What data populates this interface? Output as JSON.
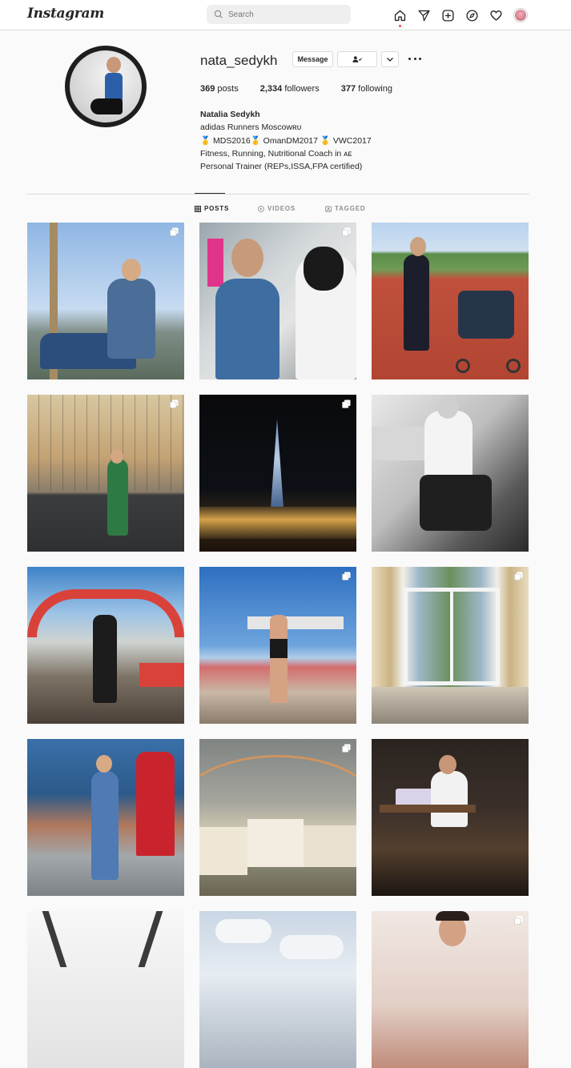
{
  "nav": {
    "logo": "Instagram",
    "search_placeholder": "Search",
    "icons": [
      "home-icon",
      "direct-icon",
      "new-post-icon",
      "explore-icon",
      "activity-icon",
      "profile-avatar"
    ]
  },
  "profile": {
    "username": "nata_sedykh",
    "message_label": "Message",
    "stats": {
      "posts_count": "369",
      "posts_label": "posts",
      "followers_count": "2,334",
      "followers_label": "followers",
      "following_count": "377",
      "following_label": "following"
    },
    "bio": {
      "name": "Natalia Sedykh",
      "line1": "adidas Runners Moscowʀᴜ",
      "line2_parts": [
        "🥇",
        " MDS2016",
        "🥇",
        " OmanDM2017 ",
        "🥇",
        " VWC2017"
      ],
      "line3": "Fitness, Running, Nutritional Coach in ᴀᴇ",
      "line4": "Personal Trainer (REPs,ISSA,FPA certified)"
    }
  },
  "tabs": [
    {
      "label": "POSTS",
      "icon": "grid-icon",
      "active": true
    },
    {
      "label": "VIDEOS",
      "icon": "video-icon",
      "active": false
    },
    {
      "label": "TAGGED",
      "icon": "tagged-icon",
      "active": false
    }
  ],
  "posts": [
    {
      "scene": "woman-by-palm-tree",
      "multi": true
    },
    {
      "scene": "makeup-artist",
      "multi": true
    },
    {
      "scene": "woman-with-stroller-at-track",
      "multi": false
    },
    {
      "scene": "pregnant-woman-on-court",
      "multi": true
    },
    {
      "scene": "burj-khalifa-night",
      "multi": true
    },
    {
      "scene": "woman-with-laptop-bw",
      "multi": false
    },
    {
      "scene": "runner-at-finish-arch",
      "multi": false
    },
    {
      "scene": "woman-in-stadium",
      "multi": true
    },
    {
      "scene": "room-with-mountain-view",
      "multi": true
    },
    {
      "scene": "woman-by-phone-booth",
      "multi": false
    },
    {
      "scene": "rainbow-over-houses",
      "multi": true
    },
    {
      "scene": "woman-at-night-terrace",
      "multi": false
    },
    {
      "scene": "footbridge",
      "multi": false
    },
    {
      "scene": "cloudy-sky",
      "multi": false
    },
    {
      "scene": "woman-smiling-pink",
      "multi": true
    }
  ],
  "colors": {
    "accent_blue": "#0095f6",
    "text": "#262626",
    "muted": "#8e8e8e",
    "border": "#dbdbdb",
    "bg": "#fafafa",
    "notification_dot": "#ed4956"
  }
}
